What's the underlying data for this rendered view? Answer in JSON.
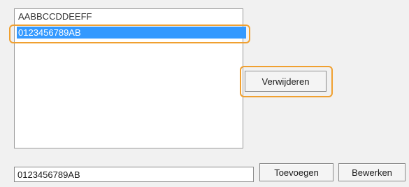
{
  "list": {
    "items": [
      {
        "label": "AABBCCDDEEFF",
        "selected": false
      },
      {
        "label": "0123456789AB",
        "selected": true
      }
    ]
  },
  "buttons": {
    "remove_label": "Verwijderen",
    "add_label": "Toevoegen",
    "edit_label": "Bewerken"
  },
  "input": {
    "value": "0123456789AB"
  },
  "colors": {
    "highlight": "#f0a030",
    "selection": "#3399ff"
  }
}
